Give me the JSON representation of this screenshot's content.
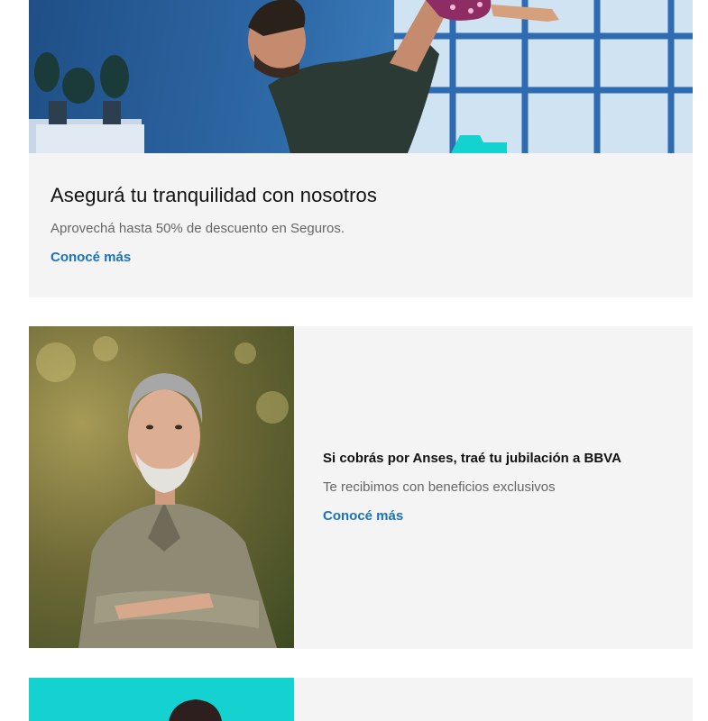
{
  "cards": [
    {
      "title": "Asegurá tu tranquilidad con nosotros",
      "description": "Aprovechá hasta 50% de descuento en Seguros.",
      "link": "Conocé más"
    },
    {
      "title": "Si cobrás por Anses, traé tu jubilación a BBVA",
      "description": "Te recibimos con beneficios exclusivos",
      "link": "Conocé más"
    }
  ],
  "colors": {
    "link": "#1973b8",
    "card_bg": "#f4f4f4",
    "title": "#121212",
    "description": "#666666",
    "teal_accent": "#14d2cf"
  }
}
